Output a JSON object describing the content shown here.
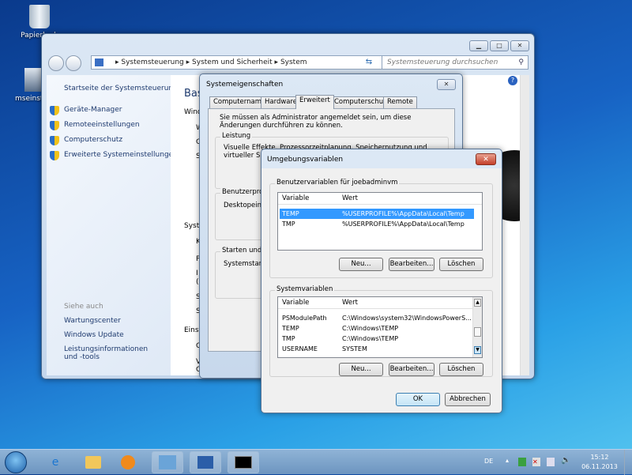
{
  "desktop": {
    "icons": [
      {
        "label": "Papierkorb"
      },
      {
        "label": "mseinstall"
      }
    ]
  },
  "explorer": {
    "breadcrumb": [
      "Systemsteuerung",
      "System und Sicherheit",
      "System"
    ],
    "search_placeholder": "Systemsteuerung durchsuchen",
    "left": {
      "home": "Startseite der Systemsteuerung",
      "tasks": [
        "Geräte-Manager",
        "Remoteeinstellungen",
        "Computerschutz",
        "Erweiterte Systemeinstellungen"
      ],
      "see_also": "Siehe auch",
      "links": [
        "Wartungscenter",
        "Windows Update",
        "Leistungsinformationen und -tools"
      ]
    },
    "content": {
      "heading": "Bas",
      "lines": [
        "Wind",
        "W",
        "C",
        "S",
        "Syste",
        "K",
        "P",
        "I",
        "(",
        "S",
        "S",
        "Einst",
        "C",
        "V",
        "C"
      ]
    }
  },
  "sysprops": {
    "title": "Systemeigenschaften",
    "tabs": [
      "Computername",
      "Hardware",
      "Erweitert",
      "Computerschutz",
      "Remote"
    ],
    "active_tab": "Erweitert",
    "admin_note": "Sie müssen als Administrator angemeldet sein, um diese Änderungen durchführen zu können.",
    "groups": [
      {
        "label": "Leistung",
        "text": "Visuelle Effekte, Prozessorzeitplanung, Speichernutzung und virtueller Speicher"
      },
      {
        "label": "Benutzerprofile",
        "text": "Desktopeinstellungen"
      },
      {
        "label": "Starten und Wiederherstellen",
        "text": "Systemstart,"
      }
    ]
  },
  "envvars": {
    "title": "Umgebungsvariablen",
    "user_group": "Benutzervariablen für joebadminvm",
    "col_variable": "Variable",
    "col_value": "Wert",
    "user_vars": [
      {
        "name": "TEMP",
        "value": "%USERPROFILE%\\AppData\\Local\\Temp",
        "selected": true
      },
      {
        "name": "TMP",
        "value": "%USERPROFILE%\\AppData\\Local\\Temp",
        "selected": false
      }
    ],
    "system_group": "Systemvariablen",
    "system_vars": [
      {
        "name": "PSModulePath",
        "value": "C:\\Windows\\system32\\WindowsPowerS..."
      },
      {
        "name": "TEMP",
        "value": "C:\\Windows\\TEMP"
      },
      {
        "name": "TMP",
        "value": "C:\\Windows\\TEMP"
      },
      {
        "name": "USERNAME",
        "value": "SYSTEM"
      }
    ],
    "btn_new": "Neu...",
    "btn_edit": "Bearbeiten...",
    "btn_delete": "Löschen",
    "btn_ok": "OK",
    "btn_cancel": "Abbrechen"
  },
  "taskbar": {
    "language": "DE",
    "time": "15:12",
    "date": "06.11.2013"
  }
}
